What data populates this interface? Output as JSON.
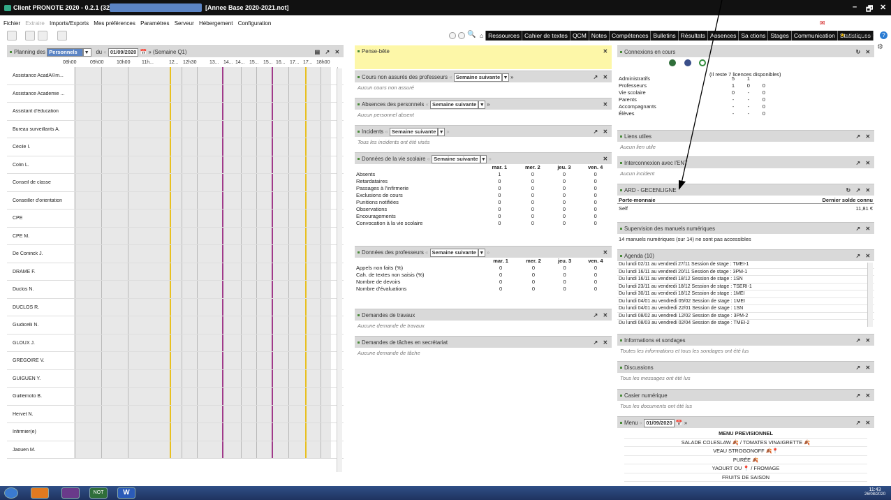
{
  "app": {
    "title": "Client PRONOTE 2020 - 0.2.1 (32bit",
    "base": "[Annee Base 2020-2021.not]",
    "win_min": "–",
    "win_max": "🗗",
    "win_close": "✕",
    "title_icon": "pronote-logo-icon"
  },
  "menu": {
    "items": [
      "Fichier",
      "Extraire",
      "Imports/Exports",
      "Mes préférences",
      "Paramètres",
      "Serveur",
      "Hébergement",
      "Configuration"
    ]
  },
  "nav": {
    "tabs": [
      "Ressources",
      "Cahier de textes",
      "QCM",
      "Notes",
      "Compétences",
      "Bulletins",
      "Résultats",
      "Absences",
      "Sa  ctions",
      "Stages",
      "Communication",
      "Statistiques"
    ],
    "assistance": "Assistance",
    "help": "?"
  },
  "planning": {
    "title": "Planning des",
    "type": "Personnels",
    "du": "du",
    "date": "01/09/2020",
    "week": "(Semaine Q1)",
    "times": [
      "08h00",
      "09h00",
      "10h00",
      "11h...",
      "12...",
      "12h30",
      "13...",
      "14...",
      "14...",
      "15...",
      "15...",
      "16...",
      "17...",
      "17...",
      "18h00"
    ],
    "rows": [
      "Assistance AcadÃ©m...",
      "Assistance Academie ...",
      "Assistant d'éducation",
      "Bureau surveillants A.",
      "Cécile I.",
      "Colin L.",
      "Conseil de classe",
      "Conseiller d'orientation",
      "CPE",
      "CPE M.",
      "De Coninck J.",
      "DRAME F.",
      "Duclos N.",
      "DUCLOS R.",
      "Giudicelli N.",
      "GLOUX J.",
      "GREGOIRE V.",
      "GUIGUEN Y.",
      "Guillemoto B.",
      "Hervet N.",
      "Infirmier(e)",
      "Jaouen M."
    ]
  },
  "pense": {
    "title": "Pense-bête"
  },
  "cours": {
    "title": "Cours non assurés des professeurs",
    "sel": "Semaine suivante",
    "empty": "Aucun cours non assuré"
  },
  "abs": {
    "title": "Absences des personnels",
    "sel": "Semaine suivante",
    "empty": "Aucun personnel absent"
  },
  "inc": {
    "title": "Incidents",
    "sel": "Semaine suivante",
    "empty": "Tous les incidents ont été visés"
  },
  "vie": {
    "title": "Données de la vie scolaire",
    "sel": "Semaine suivante",
    "cols": [
      "mar. 1",
      "mer. 2",
      "jeu. 3",
      "ven. 4"
    ],
    "rows": [
      [
        "Absents",
        "1",
        "0",
        "0",
        "0"
      ],
      [
        "Retardataires",
        "0",
        "0",
        "0",
        "0"
      ],
      [
        "Passages à l'infirmerie",
        "0",
        "0",
        "0",
        "0"
      ],
      [
        "Exclusions de cours",
        "0",
        "0",
        "0",
        "0"
      ],
      [
        "Punitions notifiées",
        "0",
        "0",
        "0",
        "0"
      ],
      [
        "Observations",
        "0",
        "0",
        "0",
        "0"
      ],
      [
        "Encouragements",
        "0",
        "0",
        "0",
        "0"
      ],
      [
        "Convocation à la vie scolaire",
        "0",
        "0",
        "0",
        "0"
      ]
    ]
  },
  "prof": {
    "title": "Données des professeurs",
    "sel": "Semaine suivante",
    "cols": [
      "mar. 1",
      "mer. 2",
      "jeu. 3",
      "ven. 4"
    ],
    "rows": [
      [
        "Appels non faits (%)",
        "0",
        "0",
        "0",
        "0"
      ],
      [
        "Cah. de textes non saisis (%)",
        "0",
        "0",
        "0",
        "0"
      ],
      [
        "Nombre de devoirs",
        "0",
        "0",
        "0",
        "0"
      ],
      [
        "Nombre d'évaluations",
        "0",
        "0",
        "0",
        "0"
      ]
    ]
  },
  "travaux": {
    "title": "Demandes de travaux",
    "empty": "Aucune demande de travaux"
  },
  "taches": {
    "title": "Demandes de tâches en secrétariat",
    "empty": "Aucune demande de tâche"
  },
  "conn": {
    "title": "Connexions en cours",
    "icons": [
      "NOT",
      "EDT",
      "close"
    ],
    "note": "(Il reste 7 licences disponibles)",
    "rows": [
      [
        "Administratifs",
        "5",
        "1",
        ""
      ],
      [
        "Professeurs",
        "1",
        "0",
        "0"
      ],
      [
        "Vie scolaire",
        "0",
        "-",
        "0"
      ],
      [
        "Parents",
        "-",
        "-",
        "0"
      ],
      [
        "Accompagnants",
        "-",
        "-",
        "0"
      ],
      [
        "Élèves",
        "-",
        "-",
        "0"
      ]
    ]
  },
  "liens": {
    "title": "Liens utiles",
    "empty": "Aucun lien utile"
  },
  "ent": {
    "title": "Interconnexion avec l'ENT",
    "empty": "Aucun incident"
  },
  "ard": {
    "title": "ARD - GECENLIGNE",
    "c1": "Porte-monnaie",
    "c2": "Dernier solde connu",
    "r1": "Self",
    "r2": "11,81 €"
  },
  "manuels": {
    "title": "Supervision des manuels numériques",
    "text": "14 manuels numériques (sur 14) ne sont pas accessibles"
  },
  "agenda": {
    "title": "Agenda (10)",
    "items": [
      [
        "Du lundi 02/11 au vendredi 27/11",
        "Session de stage : TMEI-1"
      ],
      [
        "Du lundi 16/11 au vendredi 20/11",
        "Session de stage : 3PM-1"
      ],
      [
        "Du lundi 16/11 au vendredi 18/12",
        "Session de stage : 1SN"
      ],
      [
        "Du lundi 23/11 au vendredi 18/12",
        "Session de stage : TSERI-1"
      ],
      [
        "Du lundi 30/11 au vendredi 18/12",
        "Session de stage : 1MEI"
      ],
      [
        "Du lundi 04/01 au vendredi 05/02",
        "Session de stage : 1MEI"
      ],
      [
        "Du lundi 04/01 au vendredi 22/01",
        "Session de stage : 1SN"
      ],
      [
        "Du lundi 08/02 au vendredi 12/02",
        "Session de stage : 3PM-2"
      ],
      [
        "Du lundi 08/03 au vendredi 02/04",
        "Session de stage : TMEI-2"
      ]
    ]
  },
  "infos": {
    "title": "Informations et sondages",
    "empty": "Toutes les informations et tous les sondages ont été lus"
  },
  "disc": {
    "title": "Discussions",
    "empty": "Tous les messages ont été lus"
  },
  "casier": {
    "title": "Casier numérique",
    "empty": "Tous les documents ont été lus"
  },
  "menuc": {
    "title": "Menu",
    "date": "01/09/2020",
    "lines": [
      "MENU PREVISIONNEL",
      "SALADE COLESLAW 🍂 / TOMATES VINAIGRETTE 🍂",
      "VEAU STROGONOFF 🍂📍",
      "PURÉE 🍂",
      "YAOURT OU 📍 / FROMAGE",
      "FRUITS DE SAISON"
    ]
  },
  "taskbar": {
    "time": "11:43",
    "date": "26/08/2020",
    "apps": [
      "NOT",
      "W"
    ]
  },
  "colors": {
    "accent": "#4a8a3a",
    "header": "#d9d9d9",
    "yellow": "#fdf7a8",
    "titlebar": "#111111"
  }
}
